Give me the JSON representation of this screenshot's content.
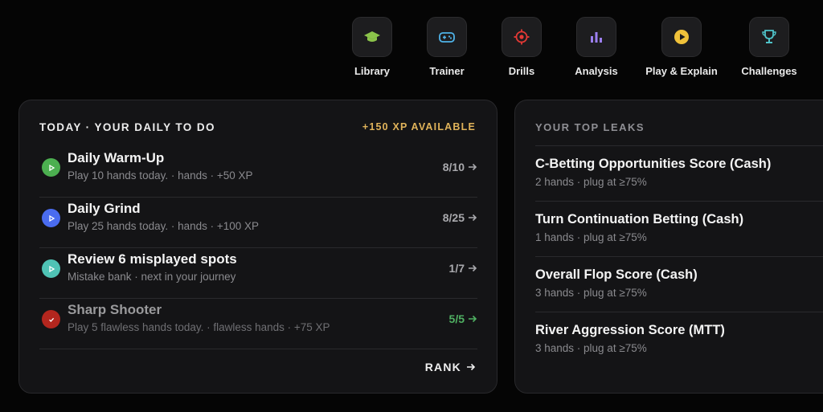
{
  "nav": [
    {
      "label": "Library",
      "icon": "graduation-cap-icon",
      "color": "#8bc34a"
    },
    {
      "label": "Trainer",
      "icon": "gamepad-icon",
      "color": "#4fb3e8"
    },
    {
      "label": "Drills",
      "icon": "crosshair-icon",
      "color": "#e53935"
    },
    {
      "label": "Analysis",
      "icon": "bar-chart-icon",
      "color": "#9c7ff0"
    },
    {
      "label": "Play & Explain",
      "icon": "play-circle-icon",
      "color": "#f0c23a"
    },
    {
      "label": "Challenges",
      "icon": "trophy-icon",
      "color": "#4fc3c9"
    }
  ],
  "daily": {
    "title": "TODAY · YOUR DAILY TO DO",
    "xp_available": "+150 XP AVAILABLE",
    "tasks": [
      {
        "title": "Daily Warm-Up",
        "sub": "Play 10 hands today. · hands · +50 XP",
        "progress": "8/10",
        "icon_color": "#4caf50",
        "icon": "play-icon"
      },
      {
        "title": "Daily Grind",
        "sub": "Play 25 hands today. · hands · +100 XP",
        "progress": "8/25",
        "icon_color": "#4a6cf0",
        "icon": "play-icon"
      },
      {
        "title": "Review 6 misplayed spots",
        "sub": "Mistake bank · next in your journey",
        "progress": "1/7",
        "icon_color": "#4fc3b5",
        "icon": "play-icon"
      },
      {
        "title": "Sharp Shooter",
        "sub": "Play 5 flawless hands today. · flawless hands · +75 XP",
        "progress": "5/5",
        "icon_color": "#b3261e",
        "icon": "check-icon"
      }
    ],
    "rank_label": "RANK"
  },
  "leaks": {
    "title": "YOUR TOP LEAKS",
    "items": [
      {
        "title": "C-Betting Opportunities Score (Cash)",
        "sub": "2 hands · plug at ≥75%"
      },
      {
        "title": "Turn Continuation Betting (Cash)",
        "sub": "1 hands · plug at ≥75%"
      },
      {
        "title": "Overall Flop Score (Cash)",
        "sub": "3 hands · plug at ≥75%"
      },
      {
        "title": "River Aggression Score (MTT)",
        "sub": "3 hands · plug at ≥75%"
      }
    ]
  }
}
